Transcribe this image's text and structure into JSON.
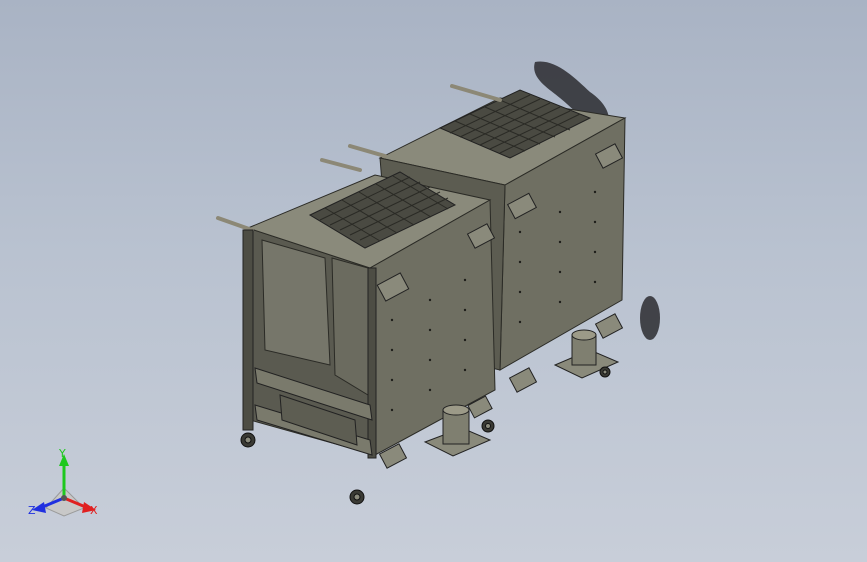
{
  "view": {
    "background_top": "#a9b3c4",
    "background_bottom": "#c8ced9",
    "part_color": "#6f6f62",
    "part_dark": "#3f3f37",
    "part_light": "#8d8d7d"
  },
  "triad": {
    "x_label": "X",
    "y_label": "Y",
    "z_label": "Z",
    "x_color": "#e02020",
    "y_color": "#1ec81e",
    "z_color": "#2030e0"
  }
}
